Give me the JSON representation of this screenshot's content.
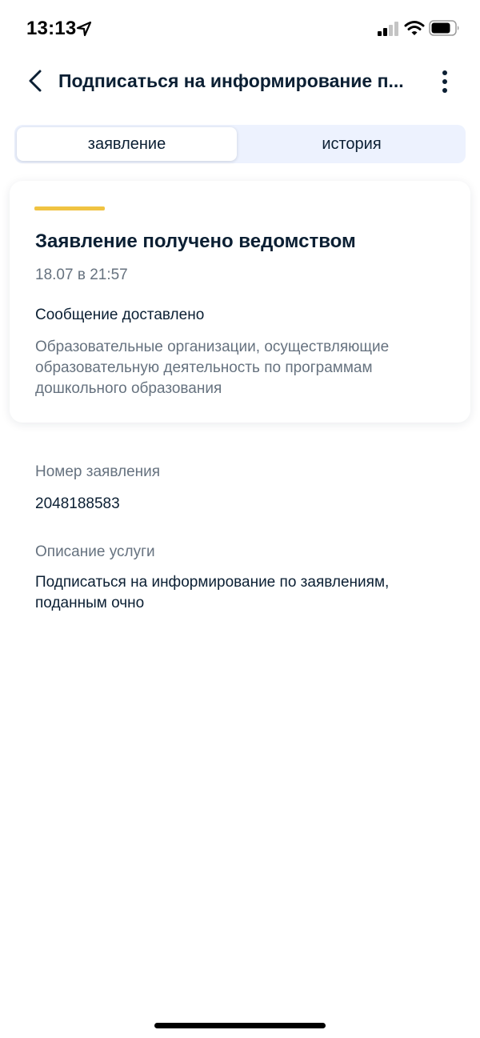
{
  "status_bar": {
    "time": "13:13",
    "icons": [
      "location-arrow-icon",
      "cellular-signal-icon",
      "wifi-icon",
      "battery-icon"
    ]
  },
  "header": {
    "title": "Подписаться на информирование п...",
    "back_icon": "chevron-left-icon",
    "more_icon": "vertical-dots-icon"
  },
  "tabs": [
    {
      "label": "заявление",
      "active": true
    },
    {
      "label": "история",
      "active": false
    }
  ],
  "status_card": {
    "accent_color": "#f0c342",
    "title": "Заявление получено ведомством",
    "date": "18.07 в 21:57",
    "message_title": "Сообщение доставлено",
    "message_text": "Образовательные организации, осуществляющие образовательную деятельность по программам дошкольного образования"
  },
  "details": {
    "number_label": "Номер заявления",
    "number_value": "2048188583",
    "description_label": "Описание услуги",
    "description_value": "Подписаться на информирование по заявлениям, поданным очно"
  },
  "colors": {
    "text_primary": "#0b1f33",
    "text_secondary": "#66727f",
    "tabs_background": "#edf2fe",
    "accent": "#f0c342"
  }
}
